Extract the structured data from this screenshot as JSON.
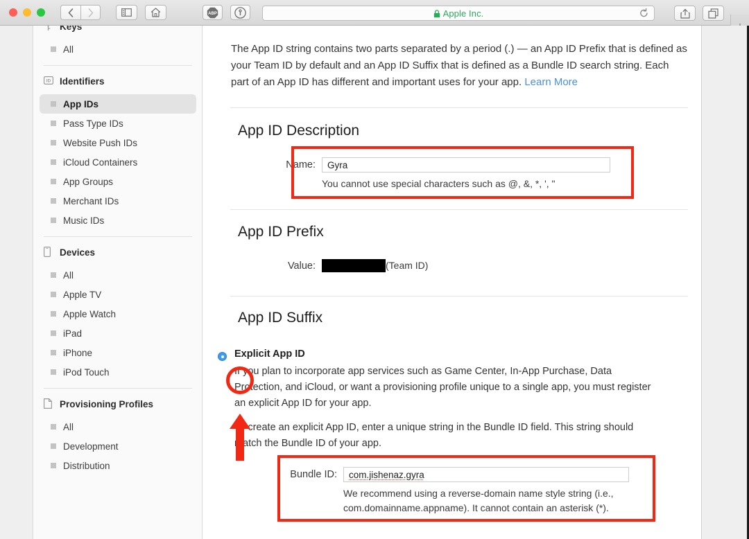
{
  "browser": {
    "url_label": "Apple Inc.",
    "lock_icon": "lock-icon",
    "reload_glyph": "↻",
    "back_glyph": "‹",
    "forward_glyph": "›",
    "sidebar_icon": "sidebar-icon",
    "home_icon": "home-icon",
    "adblock_label": "ABP",
    "onepassword_icon": "1password-icon",
    "share_icon": "share-icon",
    "tabs_icon": "show-tabs-icon",
    "new_tab_glyph": "+"
  },
  "sidebar": {
    "groups": [
      {
        "title": "Keys",
        "icon": "key-icon",
        "clipped": true,
        "items": [
          "All"
        ]
      },
      {
        "title": "Identifiers",
        "icon": "id-badge-icon",
        "items": [
          "App IDs",
          "Pass Type IDs",
          "Website Push IDs",
          "iCloud Containers",
          "App Groups",
          "Merchant IDs",
          "Music IDs"
        ],
        "selected": "App IDs"
      },
      {
        "title": "Devices",
        "icon": "iphone-icon",
        "items": [
          "All",
          "Apple TV",
          "Apple Watch",
          "iPad",
          "iPhone",
          "iPod Touch"
        ]
      },
      {
        "title": "Provisioning Profiles",
        "icon": "document-icon",
        "items": [
          "All",
          "Development",
          "Distribution"
        ]
      }
    ]
  },
  "main": {
    "intro_text": "The App ID string contains two parts separated by a period (.) — an App ID Prefix that is defined as your Team ID by default and an App ID Suffix that is defined as a Bundle ID search string. Each part of an App ID has different and important uses for your app. ",
    "intro_link": "Learn More",
    "description": {
      "heading": "App ID Description",
      "name_label": "Name:",
      "name_value": "Gyra",
      "name_hint": "You cannot use special characters such as @, &, *, ', \""
    },
    "prefix": {
      "heading": "App ID Prefix",
      "value_label": "Value:",
      "value_redacted": true,
      "value_suffix": "(Team ID)"
    },
    "suffix": {
      "heading": "App ID Suffix",
      "explicit_label": "Explicit App ID",
      "explicit_selected": true,
      "paragraph_1": "If you plan to incorporate app services such as Game Center, In-App Purchase, Data Protection, and iCloud, or want a provisioning profile unique to a single app, you must register an explicit App ID for your app.",
      "paragraph_2": "To create an explicit App ID, enter a unique string in the Bundle ID field. This string should match the Bundle ID of your app.",
      "bundle_label": "Bundle ID:",
      "bundle_value": "com.jishenaz.gyra",
      "bundle_hint_line1": "We recommend using a reverse-domain name style string (i.e.,",
      "bundle_hint_line2": "com.domainname.appname). It cannot contain an asterisk (*)."
    }
  },
  "annotations": {
    "color": "#f02814",
    "items": [
      "name-field-highlight",
      "explicit-radio-circle",
      "up-arrow",
      "bundle-id-highlight"
    ]
  }
}
